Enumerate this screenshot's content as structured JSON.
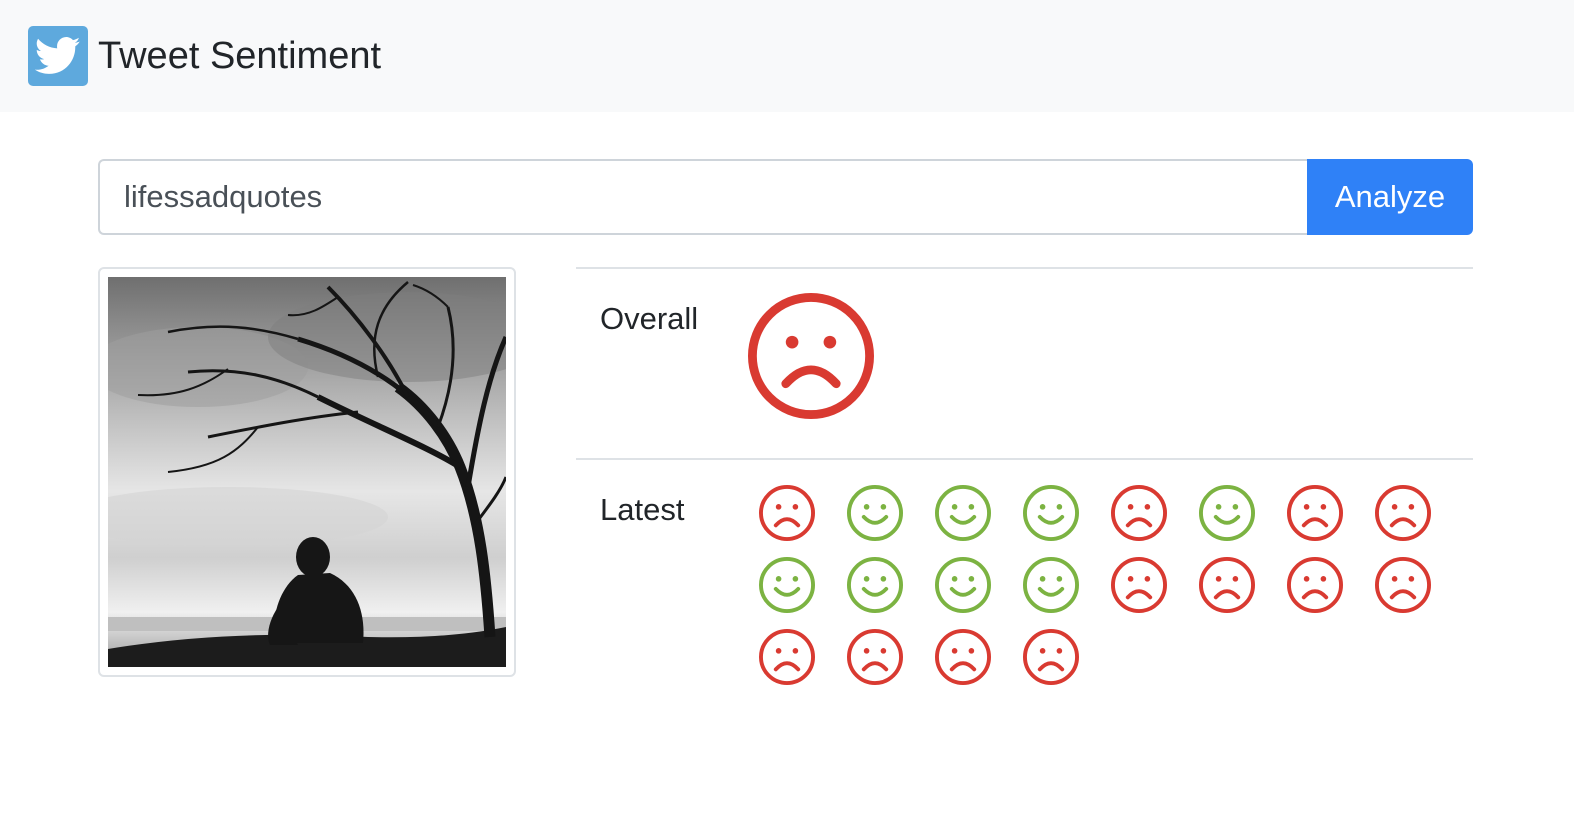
{
  "app": {
    "title": "Tweet Sentiment",
    "logo_icon": "twitter-bird-icon",
    "logo_color": "#5ea9dd"
  },
  "search": {
    "value": "lifessadquotes",
    "button_label": "Analyze",
    "button_color": "#2f81f7"
  },
  "profile": {
    "image_icon": "profile-photo"
  },
  "results": {
    "overall_label": "Overall",
    "overall_sentiment": "negative",
    "latest_label": "Latest",
    "latest_sentiments": [
      "negative",
      "positive",
      "positive",
      "positive",
      "negative",
      "positive",
      "negative",
      "negative",
      "positive",
      "positive",
      "positive",
      "positive",
      "negative",
      "negative",
      "negative",
      "negative",
      "negative",
      "negative",
      "negative",
      "negative"
    ]
  },
  "colors": {
    "positive": "#7cb342",
    "negative": "#d93a31"
  }
}
